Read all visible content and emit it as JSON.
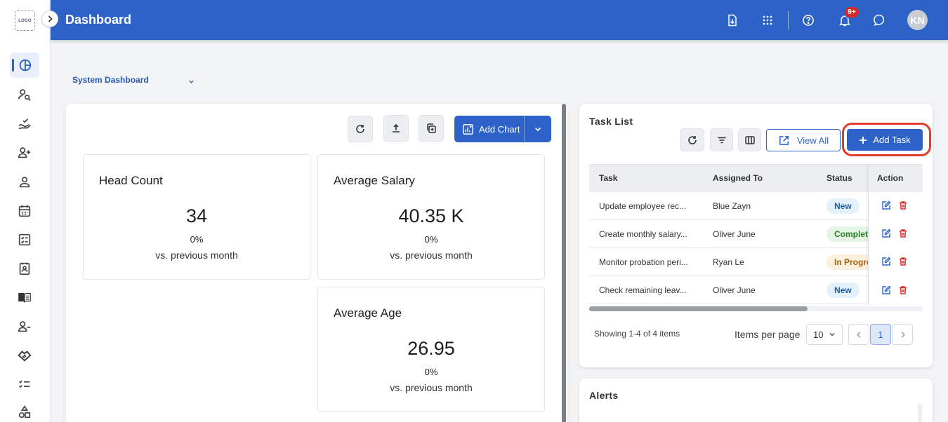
{
  "app": {
    "logo_text": "LOGO",
    "page_title": "Dashboard",
    "notification_count": "9+",
    "user_initials": "KN"
  },
  "colors": {
    "primary": "#2d63c9",
    "danger": "#d62a2a",
    "highlight": "#e33b2c"
  },
  "sidebar": {
    "items": [
      {
        "icon": "dashboard-pie-icon",
        "active": true
      },
      {
        "icon": "user-search-icon"
      },
      {
        "icon": "hand-check-icon"
      },
      {
        "icon": "user-add-icon"
      },
      {
        "icon": "user-icon"
      },
      {
        "icon": "calendar-icon"
      },
      {
        "icon": "checklist-form-icon"
      },
      {
        "icon": "id-badge-icon"
      },
      {
        "icon": "book-open-icon"
      },
      {
        "icon": "user-remove-icon"
      },
      {
        "icon": "handshake-icon"
      },
      {
        "icon": "list-check-icon"
      },
      {
        "icon": "shapes-icon"
      }
    ]
  },
  "dashboard_select": {
    "value": "System Dashboard"
  },
  "charts_toolbar": {
    "add_chart_label": "Add Chart"
  },
  "kpis": [
    {
      "title": "Head Count",
      "value": "34",
      "change": "0%",
      "comparison": "vs. previous month"
    },
    {
      "title": "Average Salary",
      "value": "40.35 K",
      "change": "0%",
      "comparison": "vs. previous month"
    },
    {
      "title": "Average Age",
      "value": "26.95",
      "change": "0%",
      "comparison": "vs. previous month"
    }
  ],
  "task_list": {
    "title": "Task List",
    "view_all_label": "View All",
    "add_task_label": "Add Task",
    "columns": [
      "Task",
      "Assigned To",
      "Status",
      "Action"
    ],
    "rows": [
      {
        "task": "Update employee rec...",
        "assigned_to": "Blue Zayn",
        "status": "New"
      },
      {
        "task": "Create monthly salary...",
        "assigned_to": "Oliver June",
        "status": "Complet"
      },
      {
        "task": "Monitor probation peri...",
        "assigned_to": "Ryan Le",
        "status": "In Progre"
      },
      {
        "task": "Check remaining leav...",
        "assigned_to": "Oliver June",
        "status": "New"
      }
    ],
    "showing_text": "Showing 1-4 of 4 items",
    "items_per_page_label": "Items per page",
    "items_per_page_value": "10",
    "current_page": "1"
  },
  "alerts": {
    "title": "Alerts"
  }
}
